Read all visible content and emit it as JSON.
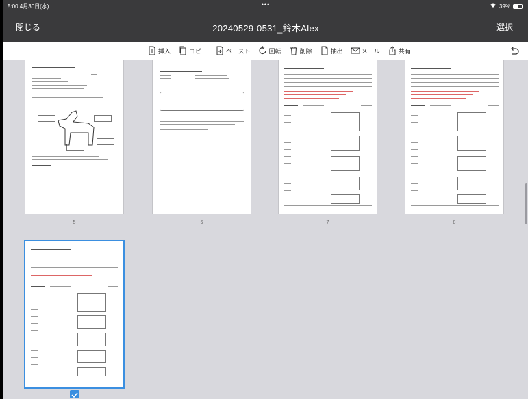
{
  "status_bar": {
    "left_text": "5:00 4月30日(水)",
    "center_dots": "•••",
    "right_text": "39%"
  },
  "nav": {
    "close_label": "閉じる",
    "title": "20240529-0531_鈴木Alex",
    "select_label": "選択"
  },
  "toolbar": {
    "items": [
      {
        "label": "挿入",
        "icon": "insert-page-icon"
      },
      {
        "label": "コピー",
        "icon": "copy-icon"
      },
      {
        "label": "ペースト",
        "icon": "paste-icon"
      },
      {
        "label": "回転",
        "icon": "rotate-icon"
      },
      {
        "label": "削除",
        "icon": "trash-icon"
      },
      {
        "label": "抽出",
        "icon": "extract-icon"
      },
      {
        "label": "メール",
        "icon": "mail-icon"
      },
      {
        "label": "共有",
        "icon": "share-icon"
      }
    ],
    "undo_icon": "undo-icon"
  },
  "pages": [
    {
      "number": "5",
      "kind": "diagram",
      "selected": false
    },
    {
      "number": "6",
      "kind": "form",
      "selected": false
    },
    {
      "number": "7",
      "kind": "table",
      "selected": false
    },
    {
      "number": "8",
      "kind": "table",
      "selected": false
    },
    {
      "number": "",
      "kind": "table",
      "selected": true
    }
  ]
}
